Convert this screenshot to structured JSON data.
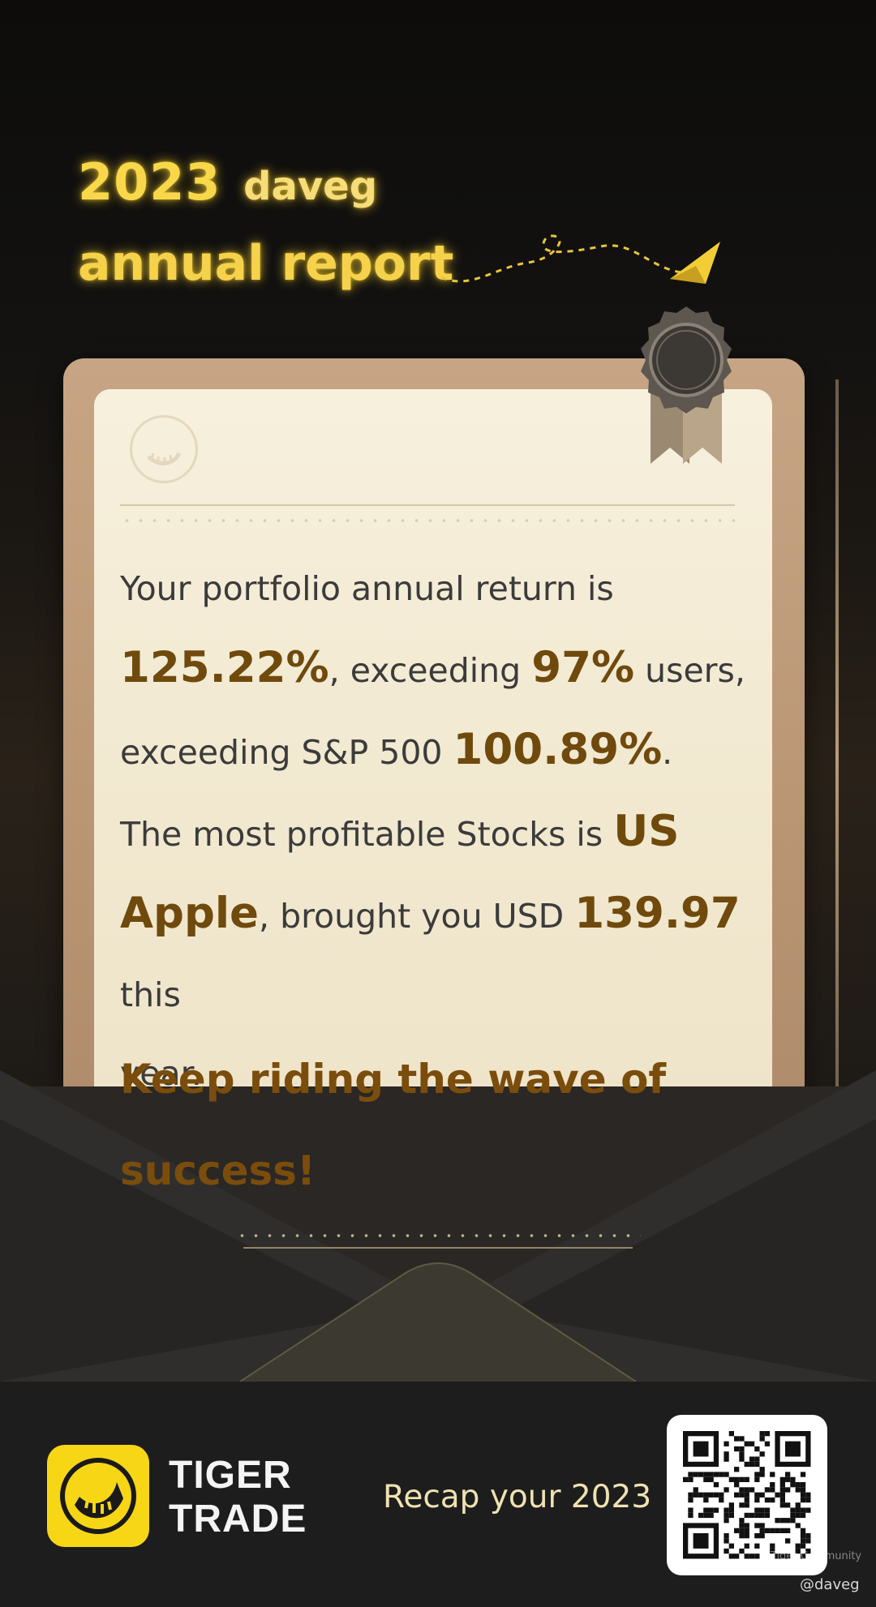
{
  "header": {
    "year": "2023",
    "username": "daveg",
    "subtitle": "annual report"
  },
  "report": {
    "line1": "Your portfolio annual return is",
    "return_value": "125.22%",
    "line2_a": ", exceeding ",
    "exceed_users": "97%",
    "line2_b": " users,",
    "line3_a": "exceeding S&P 500 ",
    "sp500_value": "100.89%",
    "line3_b": ".",
    "line4_a": "The most profitable Stocks is ",
    "stock_market": "US",
    "stock_name": "Apple",
    "line5_a": ", brought you USD ",
    "profit_value": "139.97",
    "line5_b": " this",
    "line6": "year.",
    "slogan": "Keep riding the wave of success!"
  },
  "footer": {
    "brand_line1": "TIGER",
    "brand_line2": "TRADE",
    "recap_text": "Recap your 2023",
    "watermark": "Tiger Community",
    "handle": "@daveg"
  },
  "icons": {
    "app_icon": "tiger-trade-logo-icon",
    "paper_logo": "tiger-stripe-watermark-icon",
    "seal": "wax-seal-ribbon-icon",
    "plane": "paper-plane-icon",
    "qr": "qr-code-icon"
  },
  "colors": {
    "title_yellow": "#f8d84a",
    "highlight_brown": "#6f4a0c",
    "app_icon_yellow": "#f7d616",
    "footer_bg": "#1d1d1d"
  }
}
